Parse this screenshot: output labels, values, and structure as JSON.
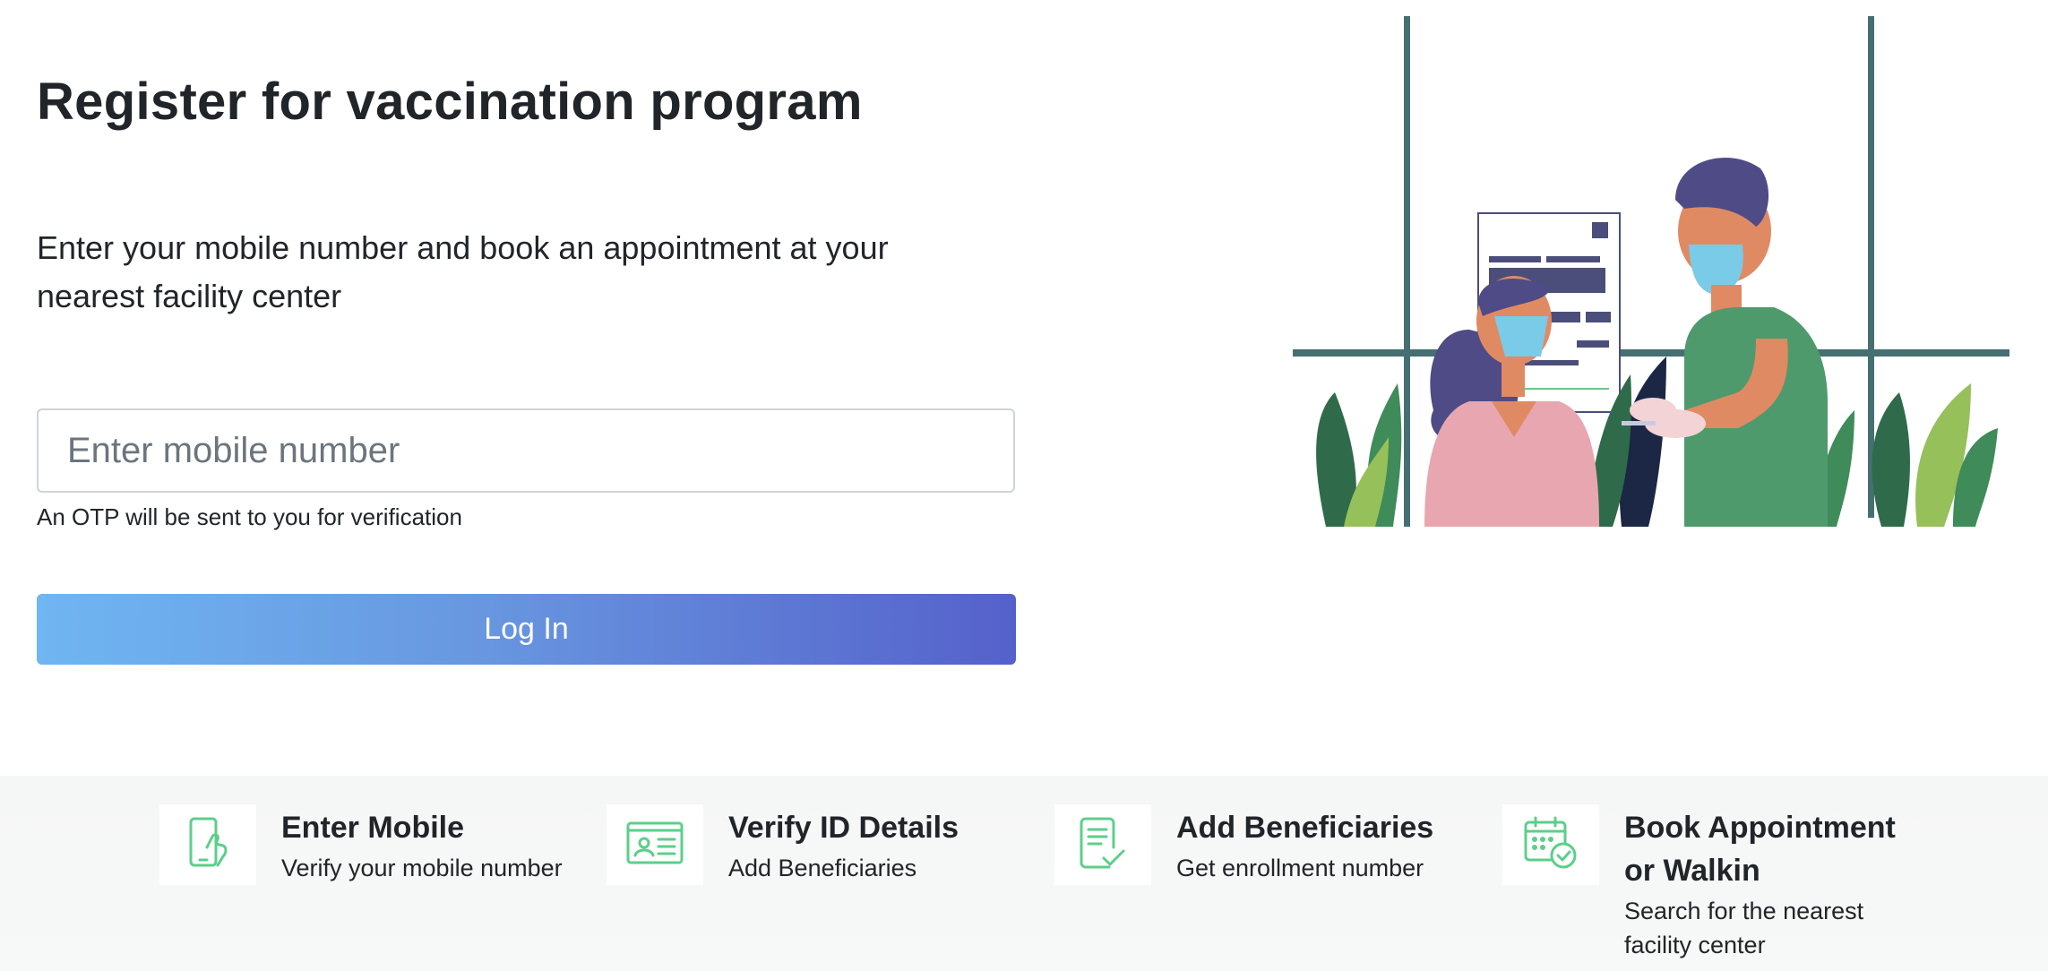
{
  "form": {
    "title": "Register for vaccination program",
    "subtitle": "Enter your mobile number and book an appointment at your nearest facility center",
    "mobile_placeholder": "Enter mobile number",
    "otp_hint": "An OTP will be sent to you for verification",
    "login_label": "Log In"
  },
  "colors": {
    "button_gradient_start": "#6fb6f2",
    "button_gradient_end": "#5561cb",
    "step_icon_green": "#5ccf8a",
    "window_frame": "#466f72"
  },
  "steps": [
    {
      "title": "Enter Mobile",
      "desc": "Verify your mobile number",
      "icon": "mobile-hand-icon"
    },
    {
      "title": "Verify ID Details",
      "desc": "Add Beneficiaries",
      "icon": "id-card-icon"
    },
    {
      "title": "Add Beneficiaries",
      "desc": "Get enrollment number",
      "icon": "document-check-icon"
    },
    {
      "title": "Book Appointment or Walkin",
      "desc": "Search for the nearest facility center",
      "icon": "calendar-check-icon"
    }
  ]
}
